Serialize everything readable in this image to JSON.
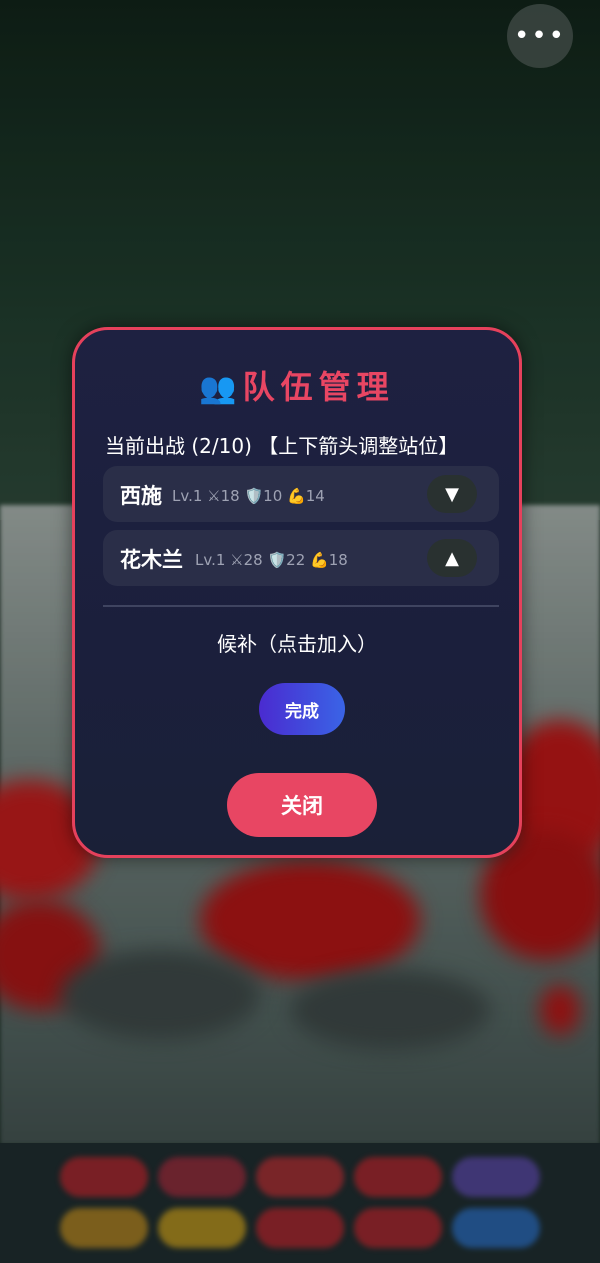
{
  "header": {
    "more_label": "•••"
  },
  "modal": {
    "title_icon": "👥",
    "title": "队伍管理",
    "active_header": "当前出战 (2/10) 【上下箭头调整站位】",
    "team": [
      {
        "name": "西施",
        "level": "Lv.1",
        "attack": "⚔18",
        "defense": "🛡️10",
        "strength": "💪14",
        "arrow": "▼"
      },
      {
        "name": "花木兰",
        "level": "Lv.1",
        "attack": "⚔28",
        "defense": "🛡️22",
        "strength": "💪18",
        "arrow": "▲"
      }
    ],
    "bench_label": "候补（点击加入）",
    "done_label": "完成",
    "close_label": "关闭"
  },
  "colors": {
    "accent": "#e84663",
    "modal_bg": "#1e2141",
    "row_bg": "#2a2e48",
    "done_gradient_start": "#4a2bd0",
    "done_gradient_end": "#3a64e6"
  }
}
